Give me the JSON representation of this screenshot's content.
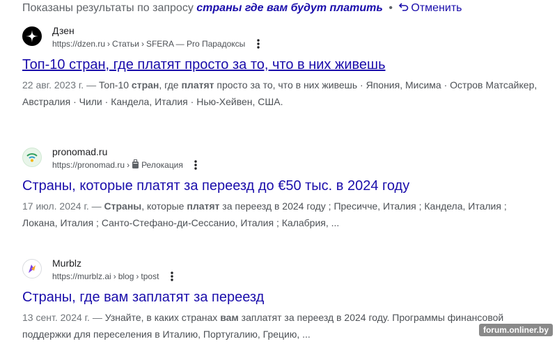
{
  "correction": {
    "prefix": "Показаны результаты по запросу",
    "query": "страны где вам будут платить",
    "separator": "•",
    "undo_label": "Отменить"
  },
  "results": [
    {
      "site_name": "Дзен",
      "url_base": "https://dzen.ru",
      "url_path_1": "Статьи",
      "url_path_2": "SFERA — Pro Парадоксы",
      "favicon": "dzen-star-icon",
      "title": "Топ-10 стран, где платят просто за то, что в них живешь",
      "snippet": {
        "date": "22 авг. 2023 г. —",
        "p1": "Топ-10",
        "b1": "стран",
        "p2": ", где",
        "b2": "платят",
        "p3": "просто за то, что в них живешь · Япония, Мисима · Остров Матсайкер, Австралия · Чили · Кандела, Италия · Нью-Хейвен, США."
      }
    },
    {
      "site_name": "pronomad.ru",
      "url_base": "https://pronomad.ru",
      "url_path_1": "Релокация",
      "favicon": "wifi-globe-icon",
      "title": "Страны, которые платят за переезд до €50 тыс. в 2024 году",
      "snippet": {
        "date": "17 июл. 2024 г. —",
        "b1": "Страны",
        "p1": ", которые",
        "b2": "платят",
        "p2": "за переезд в 2024 году ; Пресичче, Италия ; Кандела, Италия ; Локана, Италия ; Санто-Стефано-ди-Сессанио, Италия ; Калабрия, ..."
      }
    },
    {
      "site_name": "Murblz",
      "url_base": "https://murblz.ai",
      "url_path_1": "blog",
      "url_path_2": "tpost",
      "favicon": "murblz-logo-icon",
      "title": "Страны, где вам заплатят за переезд",
      "snippet": {
        "date": "13 сент. 2024 г. —",
        "p1": "Узнайте, в каких странах",
        "b1": "вам",
        "p2": "заплатят за переезд в 2024 году. Программы финансовой поддержки для переселения в Италию, Португалию, Грецию, ..."
      }
    }
  ],
  "watermark": "forum.onliner.by",
  "colors": {
    "link": "#1a0dab",
    "text": "#4d5156",
    "muted": "#70757a"
  }
}
